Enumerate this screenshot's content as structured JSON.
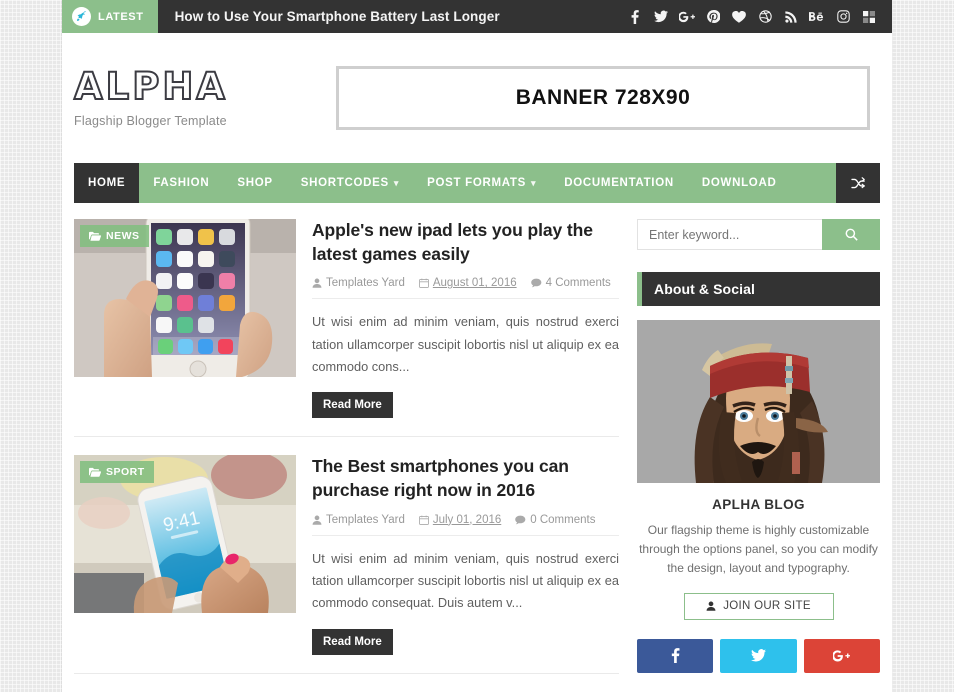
{
  "topbar": {
    "rocket_icon": "rocket-icon",
    "latest_label": "LATEST",
    "ticker_headline": "How to Use Your Smartphone Battery Last Longer",
    "social": [
      {
        "name": "facebook-icon",
        "glyph": "f"
      },
      {
        "name": "twitter-icon",
        "glyph": "t"
      },
      {
        "name": "google-plus-icon",
        "glyph": "G+"
      },
      {
        "name": "pinterest-icon",
        "glyph": "p"
      },
      {
        "name": "bloglovin-heart-icon",
        "glyph": "heart"
      },
      {
        "name": "dribbble-icon",
        "glyph": "ball"
      },
      {
        "name": "rss-icon",
        "glyph": "rss"
      },
      {
        "name": "behance-icon",
        "glyph": "Be"
      },
      {
        "name": "instagram-icon",
        "glyph": "insta"
      },
      {
        "name": "squares-icon",
        "glyph": "grid"
      }
    ]
  },
  "header": {
    "logo": "ALPHA",
    "tagline": "Flagship Blogger Template",
    "banner_text": "BANNER 728X90"
  },
  "nav": {
    "items": [
      {
        "label": "HOME",
        "active": true,
        "has_caret": false
      },
      {
        "label": "FASHION",
        "active": false,
        "has_caret": false
      },
      {
        "label": "SHOP",
        "active": false,
        "has_caret": false
      },
      {
        "label": "SHORTCODES",
        "active": false,
        "has_caret": true
      },
      {
        "label": "POST FORMATS",
        "active": false,
        "has_caret": true
      },
      {
        "label": "DOCUMENTATION",
        "active": false,
        "has_caret": false
      },
      {
        "label": "DOWNLOAD",
        "active": false,
        "has_caret": false
      }
    ],
    "shuffle_icon": "shuffle-icon"
  },
  "posts": [
    {
      "category": "NEWS",
      "thumbnail": "hand-holding-white-iphone-with-app-icons",
      "title": "Apple's new ipad lets you play the latest games easily",
      "author": "Templates Yard",
      "date": "August 01, 2016",
      "comments": "4 Comments",
      "excerpt": "Ut wisi enim ad minim veniam, quis nostrud exerci tation ullamcorper suscipit lobortis nisl ut aliquip ex ea commodo cons...",
      "read_more": "Read More"
    },
    {
      "category": "SPORT",
      "thumbnail": "hand-holding-white-iphone-over-kitchen-counter",
      "title": "The Best smartphones you can purchase right now in 2016",
      "author": "Templates Yard",
      "date": "July 01, 2016",
      "comments": "0 Comments",
      "excerpt": "Ut wisi enim ad minim veniam, quis nostrud exerci tation ullamcorper suscipit lobortis nisl ut aliquip ex ea commodo consequat. Duis autem v...",
      "read_more": "Read More"
    }
  ],
  "sidebar": {
    "search_placeholder": "Enter keyword...",
    "search_value": "",
    "search_icon": "search-icon",
    "widget_title": "About & Social",
    "avatar_alt": "cartoon-pirate-portrait",
    "about_name": "APLHA BLOG",
    "about_text": "Our flagship theme is highly customizable through the options panel, so you can modify the design, layout and typography.",
    "join_label": "JOIN OUR SITE",
    "join_icon": "user-icon",
    "social_buttons": [
      {
        "name": "facebook-share-button",
        "glyph": "f",
        "color": "#3b5999"
      },
      {
        "name": "twitter-share-button",
        "glyph": "t",
        "color": "#2ec1ec"
      },
      {
        "name": "google-plus-share-button",
        "glyph": "G+",
        "color": "#dc4437"
      }
    ]
  },
  "colors": {
    "accent_green": "#8cbf8b",
    "dark": "#333333",
    "page_bg": "#e8e8e8"
  }
}
